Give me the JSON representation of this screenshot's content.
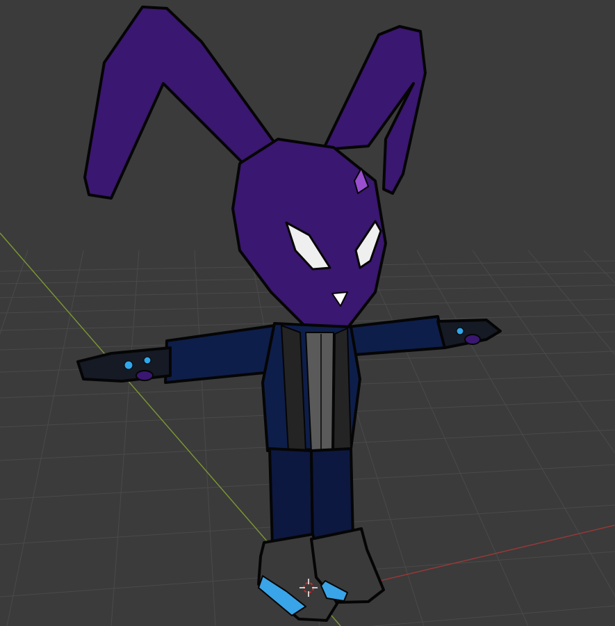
{
  "viewport": {
    "mode": "3d-viewport",
    "background_color": "#3b3b3b",
    "grid_color": "#4a4a4a",
    "x_axis_color": "#9a3838",
    "y_axis_color": "#7c9a32"
  },
  "scene": {
    "object": "bunny-character",
    "pose": "t-pose",
    "colors": {
      "fur": "#3a1770",
      "fur_dark": "#2a0f55",
      "outline": "#050505",
      "eye": "#efefef",
      "jacket": "#0e1e4a",
      "jacket_trim": "#242424",
      "shirt": "#5a5a5a",
      "pants": "#0d1840",
      "shoe": "#3a3a3a",
      "shoe_accent": "#3aa4e8",
      "glove": "#151a25",
      "glove_accent": "#32a6ea",
      "horn": "#9a4fd0"
    }
  },
  "cursor_3d": {
    "icon": "3d-cursor-icon",
    "ring_color": "#d02a2a",
    "cross_color": "#ffffff"
  }
}
